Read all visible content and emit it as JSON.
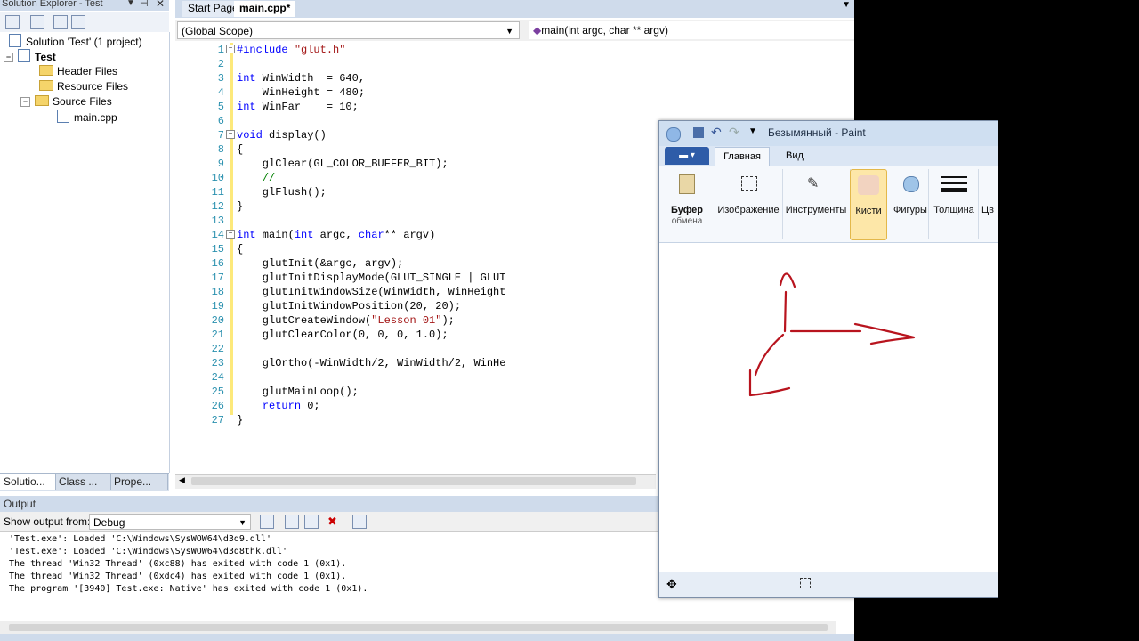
{
  "solution_explorer": {
    "title": "Solution Explorer - Test",
    "tree": {
      "solution": "Solution 'Test' (1 project)",
      "project": "Test",
      "header_files": "Header Files",
      "resource_files": "Resource Files",
      "source_files": "Source Files",
      "main_file": "main.cpp"
    },
    "tabs": [
      "Solutio...",
      "Class ...",
      "Prope..."
    ]
  },
  "editor": {
    "tabs": [
      "Start Page",
      "main.cpp*"
    ],
    "scope": "(Global Scope)",
    "function": "main(int argc, char ** argv)",
    "line_numbers": [
      "1",
      "2",
      "3",
      "4",
      "5",
      "6",
      "7",
      "8",
      "9",
      "10",
      "11",
      "12",
      "13",
      "14",
      "15",
      "16",
      "17",
      "18",
      "19",
      "20",
      "21",
      "22",
      "23",
      "24",
      "25",
      "26",
      "27"
    ],
    "lines": [
      "#include \"glut.h\"",
      "",
      "int WinWidth  = 640,",
      "    WinHeight = 480;",
      "int WinFar    = 10;",
      "",
      "void display()",
      "{",
      "    glClear(GL_COLOR_BUFFER_BIT);",
      "    //",
      "    glFlush();",
      "}",
      "",
      "int main(int argc, char** argv)",
      "{",
      "    glutInit(&argc, argv);",
      "    glutInitDisplayMode(GLUT_SINGLE | GLUT",
      "    glutInitWindowSize(WinWidth, WinHeight",
      "    glutInitWindowPosition(20, 20);",
      "    glutCreateWindow(\"Lesson 01\");",
      "    glutClearColor(0, 0, 0, 1.0);",
      "",
      "    glOrtho(-WinWidth/2, WinWidth/2, WinHe",
      "",
      "    glutMainLoop();",
      "    return 0;",
      "}"
    ]
  },
  "output": {
    "title": "Output",
    "show_from_label": "Show output from:",
    "source": "Debug",
    "lines": [
      "'Test.exe': Loaded 'C:\\Windows\\SysWOW64\\d3d9.dll'",
      "'Test.exe': Loaded 'C:\\Windows\\SysWOW64\\d3d8thk.dll'",
      "The thread 'Win32 Thread' (0xc88) has exited with code 1 (0x1).",
      "The thread 'Win32 Thread' (0xdc4) has exited with code 1 (0x1).",
      "The program '[3940] Test.exe: Native' has exited with code 1 (0x1)."
    ]
  },
  "paint": {
    "title": "Безымянный - Paint",
    "tabs": [
      "Главная",
      "Вид"
    ],
    "groups": {
      "clipboard": "Буфер",
      "clipboard_sub": "обмена",
      "image": "Изображение",
      "tools": "Инструменты",
      "brushes": "Кисти",
      "shapes": "Фигуры",
      "thickness": "Толщина",
      "colors_partial": "Цв"
    },
    "stroke_color": "#b8141e"
  }
}
